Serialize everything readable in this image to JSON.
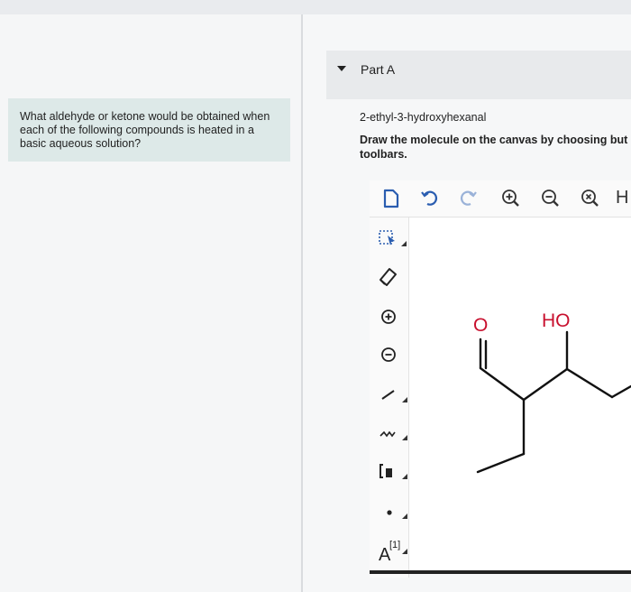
{
  "question": {
    "lines": [
      "What aldehyde or ketone would be obtained when",
      "each of the following compounds is heated in a",
      "basic aqueous solution?"
    ]
  },
  "part": {
    "title": "Part A"
  },
  "compound": "2-ethyl-3-hydroxyhexanal",
  "instructions": {
    "line1": "Draw the molecule on the canvas by choosing but",
    "line2": "toolbars."
  },
  "toolbar": {
    "icons": [
      "new-document-icon",
      "undo-icon",
      "redo-icon",
      "zoom-in-icon",
      "zoom-out-icon",
      "zoom-reset-icon"
    ],
    "h_label": "H"
  },
  "sidebar": {
    "icons": [
      "select-icon",
      "eraser-icon",
      "add-charge-icon",
      "remove-charge-icon",
      "single-bond-icon",
      "chain-icon",
      "bracket-icon",
      "radical-icon",
      "atom-label-icon"
    ],
    "atom_label": "A",
    "atom_superscript": "[1]"
  },
  "molecule": {
    "atom_o": "O",
    "atom_ho": "HO"
  },
  "colors": {
    "oxygen": "#c8102e",
    "bond": "#111111"
  }
}
